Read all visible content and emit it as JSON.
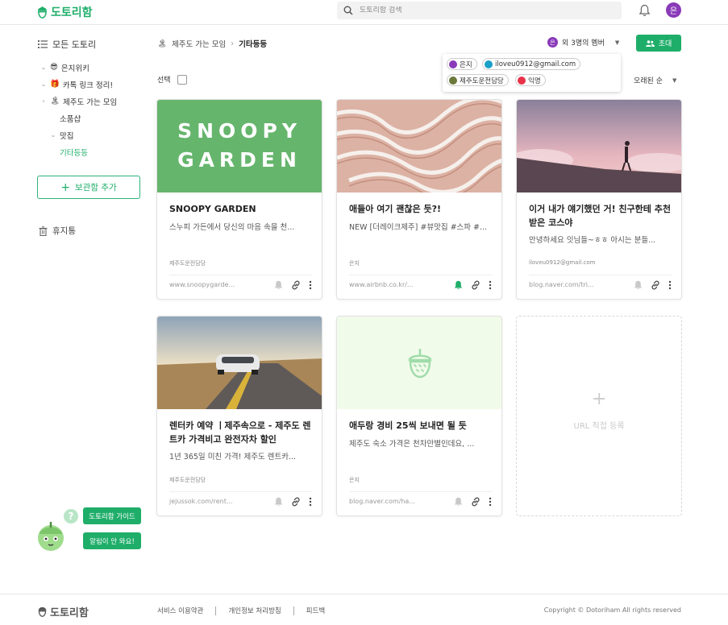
{
  "header": {
    "logo": "도토리함",
    "search_placeholder": "도토리함 검색",
    "avatar_letter": "은"
  },
  "sidebar": {
    "all_label": "모든 도토리",
    "items": [
      {
        "chev": "⌄",
        "emoji": "😎",
        "label": "은지위키"
      },
      {
        "chev": "⌄",
        "emoji": "🎁",
        "label": "카톡 링크 정리!"
      },
      {
        "chev": "›",
        "emoji": "🏝",
        "label": "제주도 가는 모임"
      },
      {
        "chev": "",
        "emoji": "",
        "label": "소품샵"
      },
      {
        "chev": "⌄",
        "emoji": "",
        "label": "맛집"
      },
      {
        "chev": "",
        "emoji": "",
        "label": "기타등등"
      }
    ],
    "add_label": "보관함 추가",
    "trash_label": "휴지통"
  },
  "breadcrumb": {
    "emoji": "🏝",
    "parent": "제주도 가는 모임",
    "current": "기타등등"
  },
  "members": {
    "avatar_letter": "은",
    "label": "외 3명의 멤버",
    "invite_label": "초대",
    "chips": [
      {
        "name": "은지",
        "color": "#8a3ab9"
      },
      {
        "name": "iloveu0912@gmail.com",
        "color": "#1aa0c8"
      },
      {
        "name": "제주도운전담당",
        "color": "#6b7a3a"
      },
      {
        "name": "익명",
        "color": "#e8334a"
      }
    ]
  },
  "toolbar": {
    "select_label": "선택",
    "sort_label": "오래된 순"
  },
  "cards": [
    {
      "title": "SNOOPY GARDEN",
      "desc": "스누피 가든에서 당신의 마음 속을 천...",
      "author": "제주도운전담당",
      "url": "www.snoopygarde...",
      "thumb_text_1": "SNOOPY",
      "thumb_text_2": "GARDEN",
      "bell_active": false
    },
    {
      "title": "애들아 여기 괜찮은 듯?!",
      "desc": "NEW [더레이크제주] #뷰맛집 #스파 #...",
      "author": "은지",
      "url": "www.airbnb.co.kr/...",
      "bell_active": true
    },
    {
      "title": "이거 내가 얘기했던 거! 친구한테 추천받은 코스야",
      "desc": "안녕하세요 잇님들~ㅎㅎ 아시는 분들...",
      "author": "iloveu0912@gmail.com",
      "url": "blog.naver.com/tri...",
      "bell_active": false
    },
    {
      "title": "렌터카 예약 ㅣ제주속으로 - 제주도 렌트카 가격비고 완전자차 할인",
      "desc": "1년 365일 미친 가격! 제주도 렌트카...",
      "author": "제주도운전담당",
      "url": "jejussok.com/rent...",
      "bell_active": false
    },
    {
      "title": "애두랑 경비 25씩 보내면 될 듯",
      "desc": "제주도 숙소 가격은 천차만별인데요, ...",
      "author": "은지",
      "url": "blog.naver.com/ha...",
      "bell_active": false
    }
  ],
  "url_register": {
    "plus": "+",
    "label": "URL 직접 등록"
  },
  "help": {
    "qmark": "?",
    "guide_label": "도토리함 가이드",
    "alarm_label": "알림이 안 와요!"
  },
  "footer": {
    "logo": "도토리함",
    "links": [
      "서비스 이용약관",
      "개인정보 처리방침",
      "피드백"
    ],
    "copyright": "Copyright © Dotoriham All rights reserved"
  },
  "colors": {
    "brand": "#1fae6a",
    "bell_active": "#1fae6a",
    "bell_inactive": "#c9c9c9"
  }
}
